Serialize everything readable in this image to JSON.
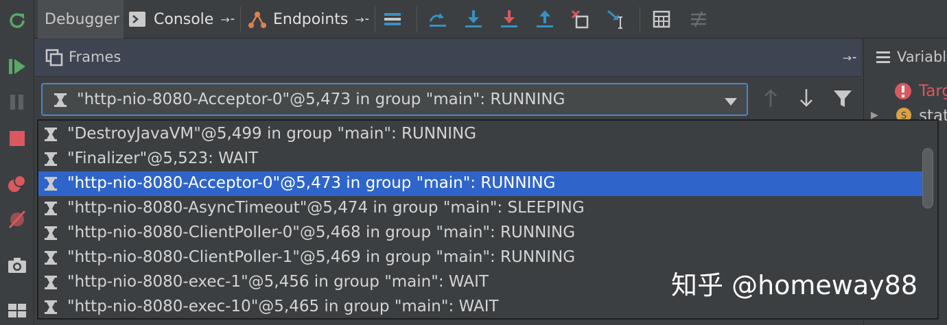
{
  "tabs": {
    "debugger": "Debugger",
    "console": "Console",
    "endpoints": "Endpoints",
    "pin_glyph": "→⁃"
  },
  "frames": {
    "title": "Frames",
    "pin_glyph": "→⁃"
  },
  "variables": {
    "title_partial": "Variabl",
    "target_partial": "Targ",
    "static_partial": "stati"
  },
  "thread_selector": {
    "selected": "\"http-nio-8080-Acceptor-0\"@5,473 in group \"main\": RUNNING"
  },
  "thread_list": [
    "\"DestroyJavaVM\"@5,499 in group \"main\": RUNNING",
    "\"Finalizer\"@5,523: WAIT",
    "\"http-nio-8080-Acceptor-0\"@5,473 in group \"main\": RUNNING",
    "\"http-nio-8080-AsyncTimeout\"@5,474 in group \"main\": SLEEPING",
    "\"http-nio-8080-ClientPoller-0\"@5,468 in group \"main\": RUNNING",
    "\"http-nio-8080-ClientPoller-1\"@5,469 in group \"main\": RUNNING",
    "\"http-nio-8080-exec-1\"@5,456 in group \"main\": WAIT",
    "\"http-nio-8080-exec-10\"@5,465 in group \"main\": WAIT"
  ],
  "selected_index": 2,
  "watermark": "知乎 @homeway88",
  "colors": {
    "selection": "#2f65ca",
    "focus_border": "#4a88c7",
    "resume_green": "#59a869",
    "stop_red": "#db5860",
    "step_blue": "#3592c4"
  }
}
